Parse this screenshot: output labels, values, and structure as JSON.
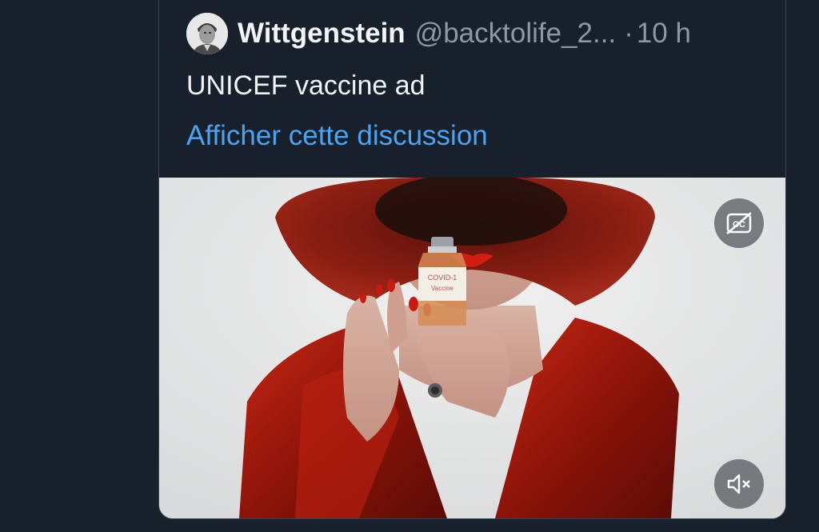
{
  "tweet": {
    "author_name": "Wittgenstein",
    "author_handle": "@backtolife_2...",
    "separator": "·",
    "timestamp": "10 h",
    "text": "UNICEF vaccine ad",
    "thread_link_label": "Afficher cette discussion"
  },
  "media": {
    "vial_label_line1": "COVID-1",
    "vial_label_line2": "Vaccine",
    "controls": {
      "captions_icon": "closed-captions-off-icon",
      "mute_icon": "volume-muted-icon"
    }
  },
  "colors": {
    "background": "#18202b",
    "text_primary": "#f1f3f5",
    "text_secondary": "#8b98a5",
    "link": "#4ba3f2",
    "hat_red": "#7a1a12",
    "jacket_red": "#9a1a0e"
  }
}
